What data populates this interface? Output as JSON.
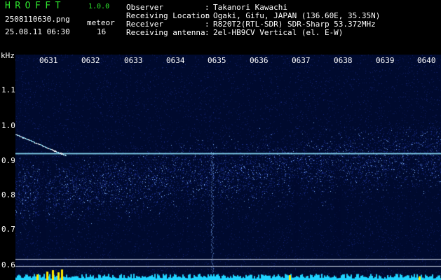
{
  "header": {
    "app_title": "HROFFT",
    "version": "1.0.0",
    "file_name": "2508110630.png",
    "mode": "meteor",
    "datetime": "25.08.11 06:30",
    "count": "16"
  },
  "station_info": [
    {
      "label": "Observer",
      "value": "Takanori Kawachi"
    },
    {
      "label": "Receiving Location",
      "value": "Ogaki, Gifu, JAPAN (136.60E, 35.35N)"
    },
    {
      "label": "Receiver",
      "value": "R820T2(RTL-SDR) SDR-Sharp 53.372MHz"
    },
    {
      "label": "Receiving antenna",
      "value": "2el-HB9CV Vertical (el. E-W)"
    }
  ],
  "spectrogram": {
    "y_axis_unit": "kHz",
    "y_ticks": [
      "1.1",
      "1.0",
      "0.9",
      "0.8",
      "0.7",
      "0.6"
    ],
    "x_ticks": [
      "0631",
      "0632",
      "0633",
      "0634",
      "0635",
      "0636",
      "0637",
      "0638",
      "0639",
      "0640"
    ],
    "colors": {
      "background": "#000a2e",
      "noise": "#1c2f8c",
      "signal": "#7fb2ff",
      "carrier": "#8ee6ff",
      "level_bars": "#1fd3ff",
      "level_peaks": "#ffe800"
    }
  }
}
